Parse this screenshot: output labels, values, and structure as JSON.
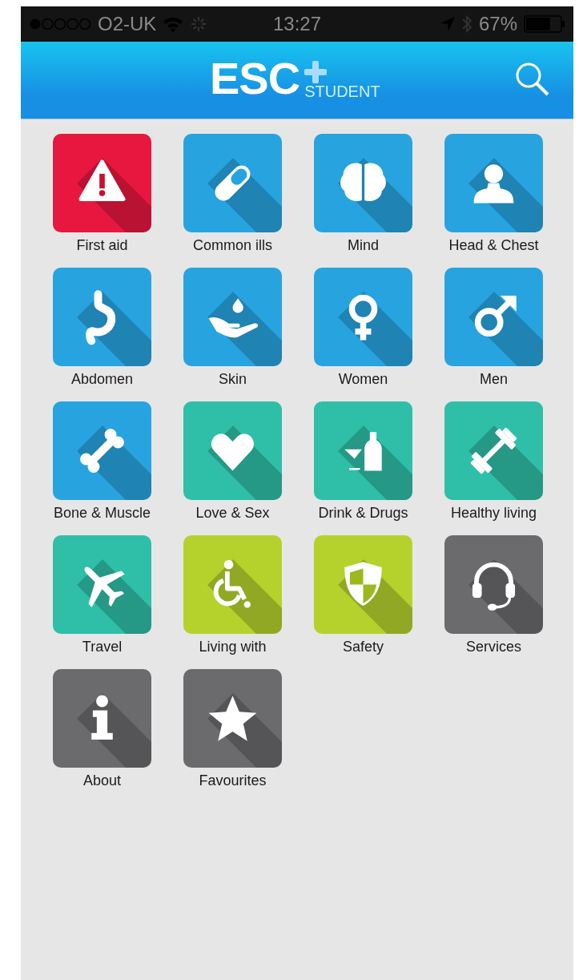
{
  "status_bar": {
    "carrier": "O2-UK",
    "time": "13:27",
    "battery": "67%"
  },
  "header": {
    "logo": "ESC",
    "logo_sub": "STUDENT"
  },
  "tiles": [
    {
      "label": "First aid",
      "kind": "warning",
      "color": "#e8173f"
    },
    {
      "label": "Common ills",
      "kind": "pill",
      "color": "#27a4e0"
    },
    {
      "label": "Mind",
      "kind": "brain",
      "color": "#27a4e0"
    },
    {
      "label": "Head & Chest",
      "kind": "bust",
      "color": "#27a4e0"
    },
    {
      "label": "Abdomen",
      "kind": "stomach",
      "color": "#27a4e0"
    },
    {
      "label": "Skin",
      "kind": "hand",
      "color": "#27a4e0"
    },
    {
      "label": "Women",
      "kind": "female",
      "color": "#27a4e0"
    },
    {
      "label": "Men",
      "kind": "male",
      "color": "#27a4e0"
    },
    {
      "label": "Bone & Muscle",
      "kind": "bone",
      "color": "#27a4e0"
    },
    {
      "label": "Love & Sex",
      "kind": "heart",
      "color": "#2fbfa8"
    },
    {
      "label": "Drink & Drugs",
      "kind": "drink",
      "color": "#2fbfa8"
    },
    {
      "label": "Healthy living",
      "kind": "dumbbell",
      "color": "#2fbfa8"
    },
    {
      "label": "Travel",
      "kind": "plane",
      "color": "#2fbfa8"
    },
    {
      "label": "Living with",
      "kind": "wheelchair",
      "color": "#b5d22c"
    },
    {
      "label": "Safety",
      "kind": "shield",
      "color": "#b5d22c"
    },
    {
      "label": "Services",
      "kind": "headset",
      "color": "#6b6b6d"
    },
    {
      "label": "About",
      "kind": "info",
      "color": "#6b6b6d"
    },
    {
      "label": "Favourites",
      "kind": "star",
      "color": "#6b6b6d"
    }
  ]
}
